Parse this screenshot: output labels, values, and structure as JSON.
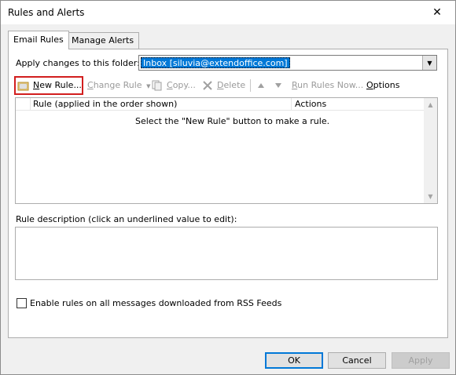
{
  "window": {
    "title": "Rules and Alerts",
    "close_glyph": "✕"
  },
  "tabs": [
    {
      "label": "Email Rules",
      "active": true
    },
    {
      "label": "Manage Alerts",
      "active": false
    }
  ],
  "folder": {
    "label": "Apply changes to this folder:",
    "value": "Inbox [siluvia@extendoffice.com]"
  },
  "toolbar": {
    "new_rule": "New Rule...",
    "change_rule": "Change Rule",
    "copy": "Copy...",
    "delete": "Delete",
    "run_rules": "Run Rules Now...",
    "options": "Options"
  },
  "rules_list": {
    "columns": [
      "Rule (applied in the order shown)",
      "Actions"
    ],
    "empty_message": "Select the \"New Rule\" button to make a rule."
  },
  "description": {
    "label": "Rule description (click an underlined value to edit):"
  },
  "rss": {
    "label": "Enable rules on all messages downloaded from RSS Feeds",
    "checked": false
  },
  "buttons": {
    "ok": "OK",
    "cancel": "Cancel",
    "apply": "Apply"
  },
  "colors": {
    "highlight": "#0078d7",
    "callout": "#d21e1e"
  }
}
